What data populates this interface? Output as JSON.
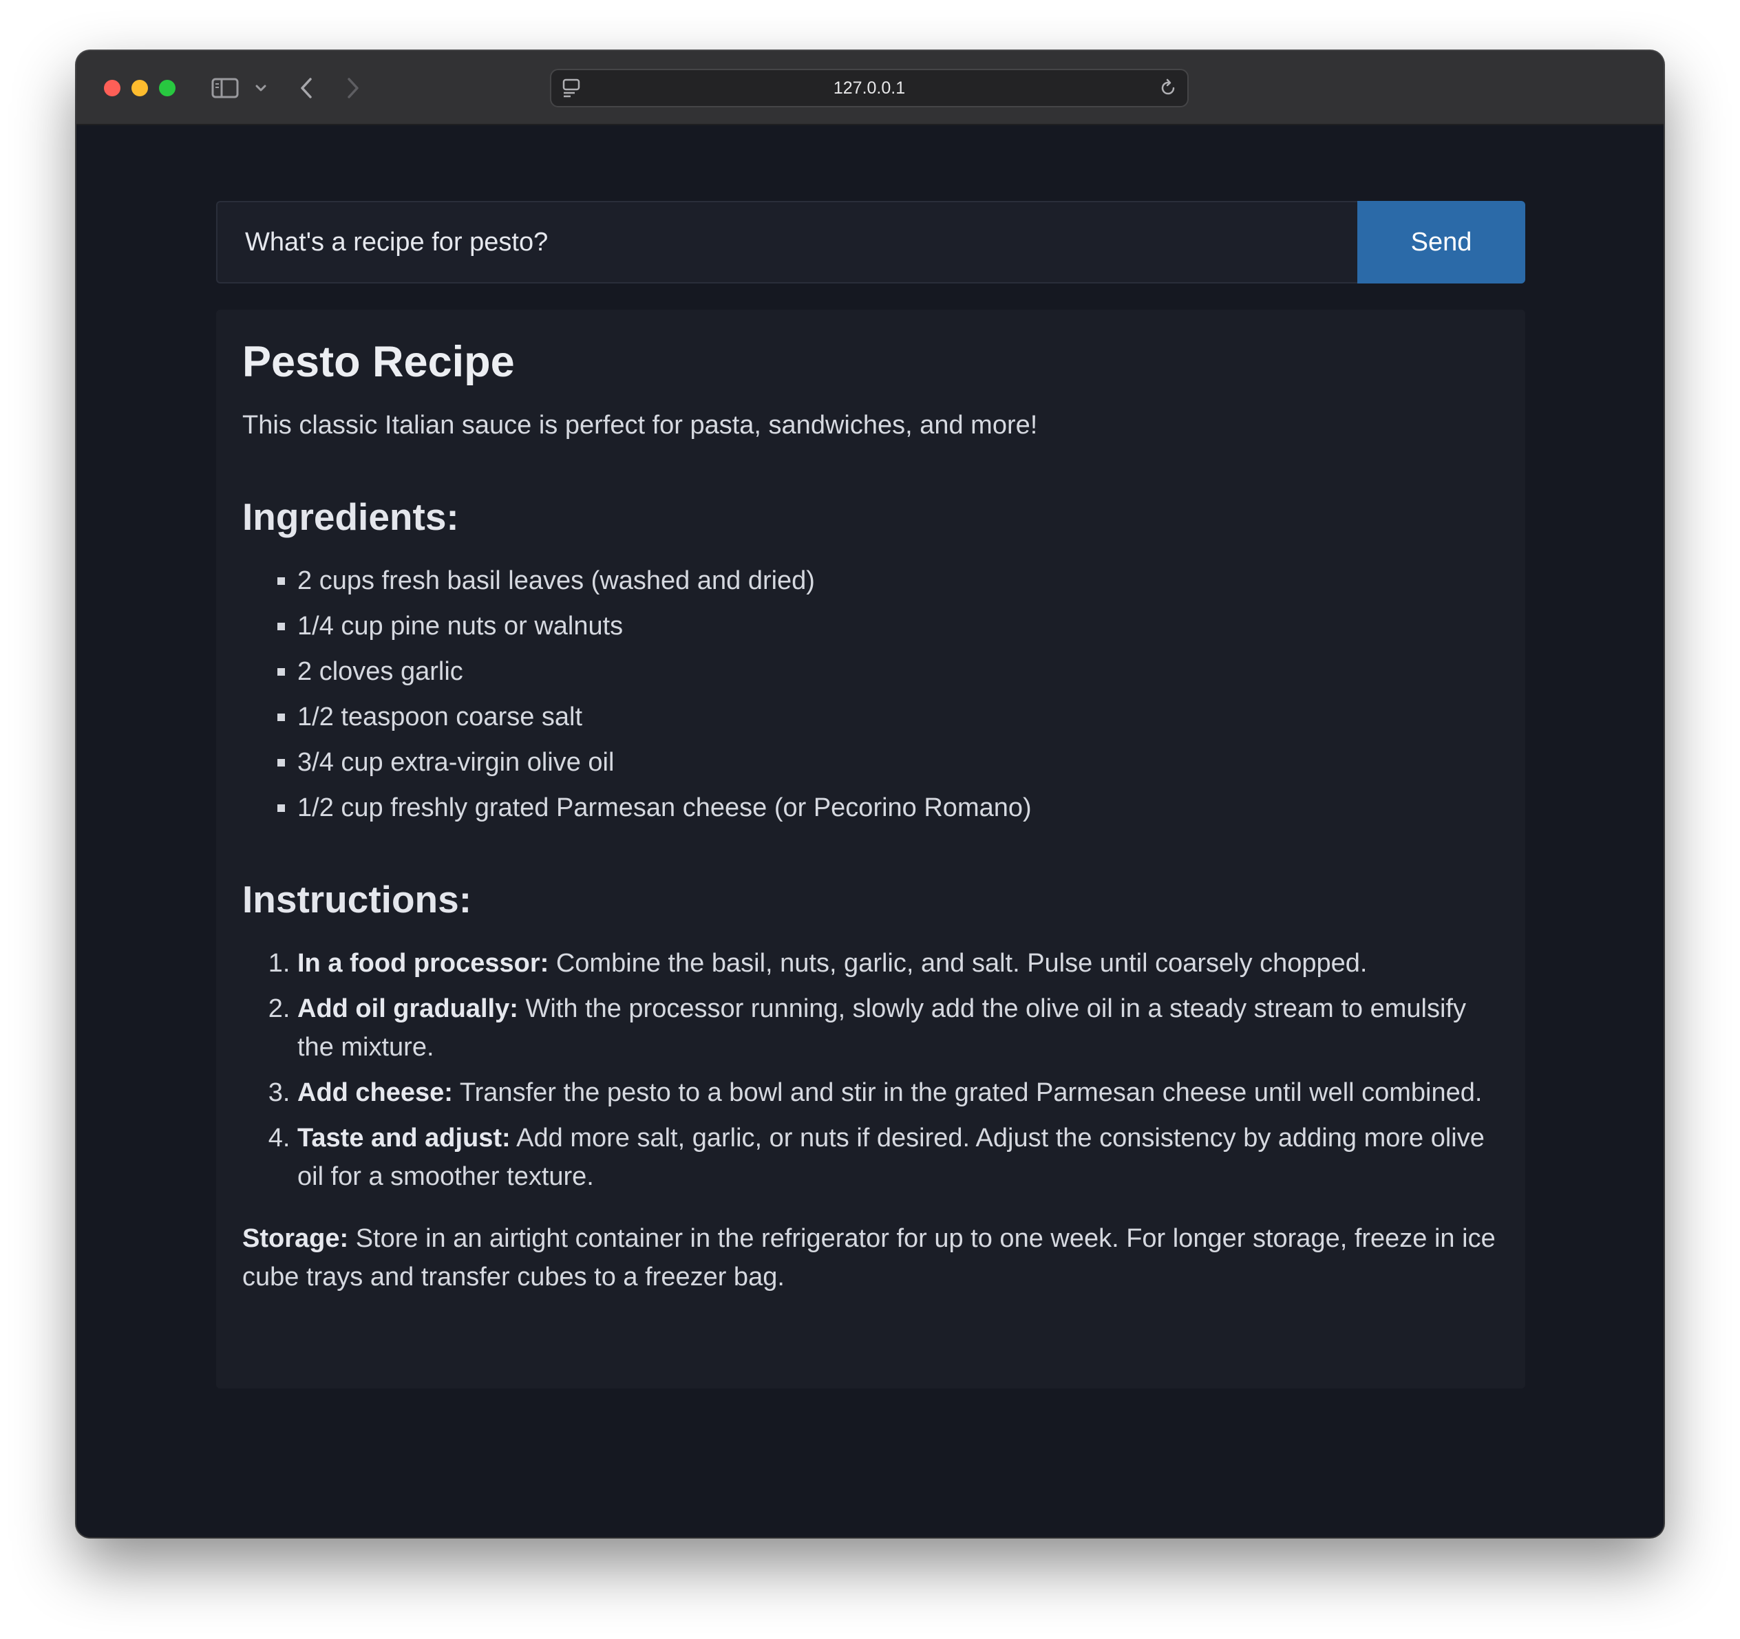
{
  "browser": {
    "url": "127.0.0.1"
  },
  "query": {
    "value": "What's a recipe for pesto?",
    "send_label": "Send"
  },
  "response": {
    "title": "Pesto Recipe",
    "intro": "This classic Italian sauce is perfect for pasta, sandwiches, and more!",
    "ingredients_heading": "Ingredients:",
    "ingredients": [
      "2 cups fresh basil leaves (washed and dried)",
      "1/4 cup pine nuts or walnuts",
      "2 cloves garlic",
      "1/2 teaspoon coarse salt",
      "3/4 cup extra-virgin olive oil",
      "1/2 cup freshly grated Parmesan cheese (or Pecorino Romano)"
    ],
    "instructions_heading": "Instructions:",
    "instructions": [
      {
        "lead": "In a food processor:",
        "text": " Combine the basil, nuts, garlic, and salt. Pulse until coarsely chopped."
      },
      {
        "lead": "Add oil gradually:",
        "text": " With the processor running, slowly add the olive oil in a steady stream to emulsify the mixture."
      },
      {
        "lead": "Add cheese:",
        "text": " Transfer the pesto to a bowl and stir in the grated Parmesan cheese until well combined."
      },
      {
        "lead": "Taste and adjust:",
        "text": " Add more salt, garlic, or nuts if desired. Adjust the consistency by adding more olive oil for a smoother texture."
      }
    ],
    "storage_lead": "Storage:",
    "storage_text": " Store in an airtight container in the refrigerator for up to one week. For longer storage, freeze in ice cube trays and transfer cubes to a freezer bag."
  },
  "colors": {
    "accent": "#2b6aa8",
    "background": "#151821",
    "panel": "#1b1e27"
  },
  "icons": [
    "sidebar-icon",
    "chevron-down-icon",
    "back-arrow-icon",
    "forward-arrow-icon",
    "page-icon",
    "reload-icon"
  ]
}
